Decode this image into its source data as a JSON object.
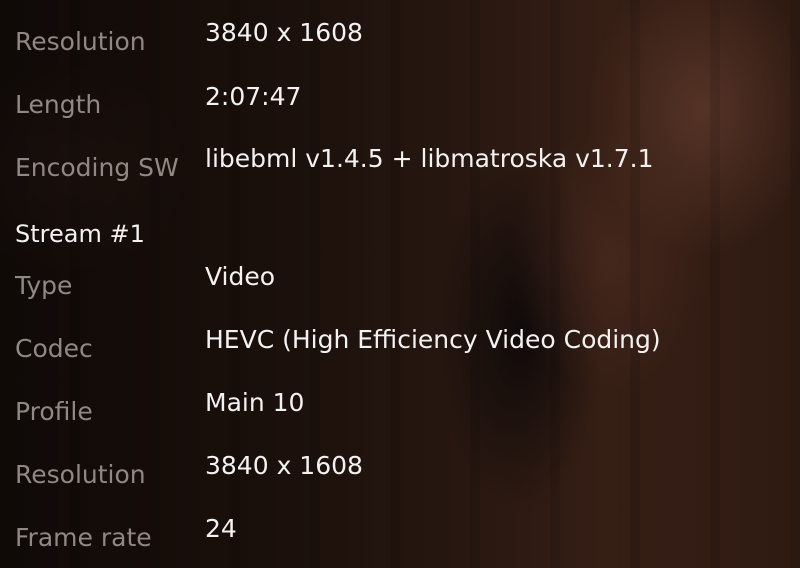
{
  "general": {
    "resolution_label": "Resolution",
    "resolution_value": "3840 x 1608",
    "length_label": "Length",
    "length_value": "2:07:47",
    "encoding_label": "Encoding SW",
    "encoding_value": "libebml v1.4.5 + libmatroska v1.7.1"
  },
  "stream1": {
    "heading": "Stream #1",
    "type_label": "Type",
    "type_value": "Video",
    "codec_label": "Codec",
    "codec_value": "HEVC (High Efficiency Video Coding)",
    "profile_label": "Profile",
    "profile_value": "Main 10",
    "resolution_label": "Resolution",
    "resolution_value": "3840 x 1608",
    "framerate_label": "Frame rate",
    "framerate_value": "24"
  }
}
